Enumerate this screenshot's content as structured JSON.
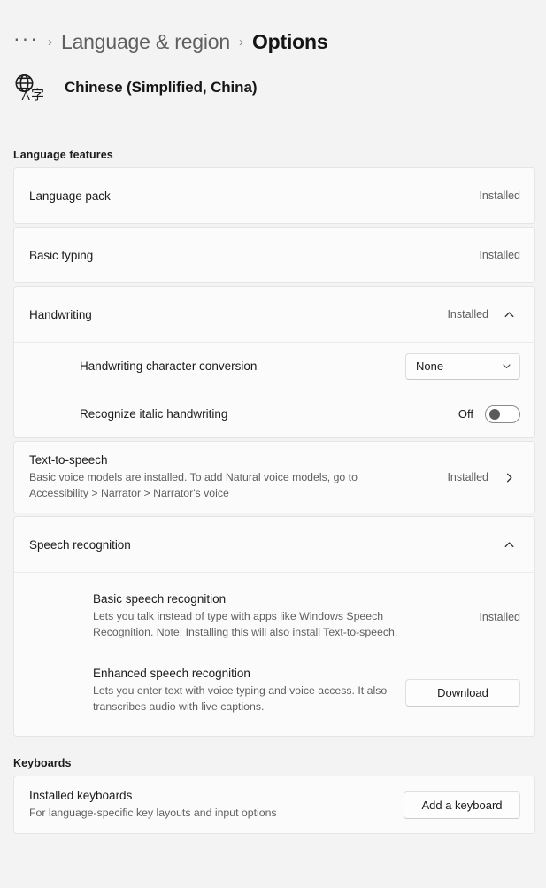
{
  "breadcrumb": {
    "ellipsis": "···",
    "separator": "›",
    "parent": "Language & region",
    "current": "Options"
  },
  "language_header": {
    "icon": "language-globe-icon",
    "name": "Chinese (Simplified, China)"
  },
  "sections": {
    "language_features": {
      "title": "Language features",
      "language_pack": {
        "label": "Language pack",
        "status": "Installed"
      },
      "basic_typing": {
        "label": "Basic typing",
        "status": "Installed"
      },
      "handwriting": {
        "label": "Handwriting",
        "status": "Installed",
        "expand_icon": "chevron-up-icon",
        "character_conversion": {
          "label": "Handwriting character conversion",
          "value": "None",
          "dropdown_icon": "chevron-down-icon"
        },
        "italic_handwriting": {
          "label": "Recognize italic handwriting",
          "state": "Off"
        }
      },
      "text_to_speech": {
        "title": "Text-to-speech",
        "description": "Basic voice models are installed. To add Natural voice models, go to Accessibility > Narrator > Narrator's voice",
        "status": "Installed",
        "nav_icon": "chevron-right-icon"
      },
      "speech_recognition": {
        "label": "Speech recognition",
        "expand_icon": "chevron-up-icon",
        "items": [
          {
            "title": "Basic speech recognition",
            "description": "Lets you talk instead of type with apps like Windows Speech Recognition. Note: Installing this will also install Text-to-speech.",
            "status": "Installed"
          },
          {
            "title": "Enhanced speech recognition",
            "description": "Lets you enter text with voice typing and voice access. It also transcribes audio with live captions.",
            "action_label": "Download"
          }
        ]
      }
    },
    "keyboards": {
      "title": "Keyboards",
      "installed_keyboards": {
        "title": "Installed keyboards",
        "description": "For language-specific key layouts and input options",
        "action_label": "Add a keyboard"
      }
    }
  }
}
